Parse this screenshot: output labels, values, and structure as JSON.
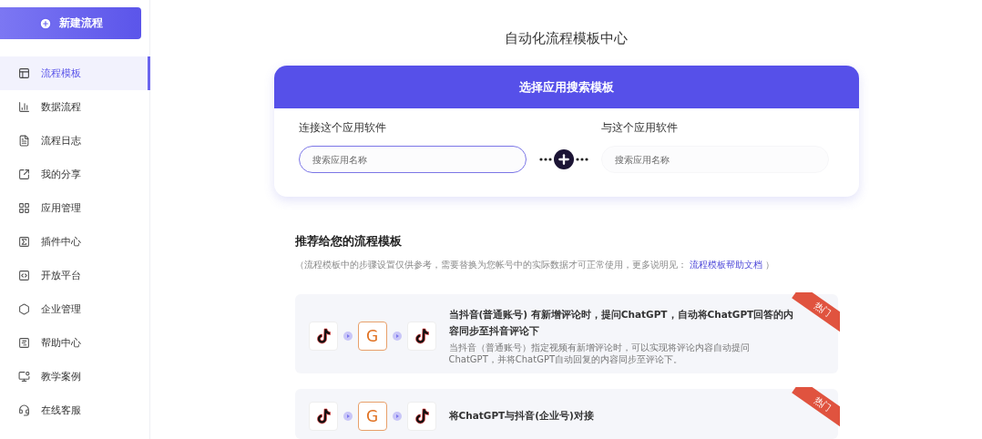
{
  "sidebar": {
    "new_button": "新建流程",
    "items": [
      {
        "label": "流程模板",
        "selected": true
      },
      {
        "label": "数据流程",
        "selected": false
      },
      {
        "label": "流程日志",
        "selected": false
      },
      {
        "label": "我的分享",
        "selected": false
      },
      {
        "label": "应用管理",
        "selected": false
      },
      {
        "label": "插件中心",
        "selected": false
      },
      {
        "label": "开放平台",
        "selected": false
      },
      {
        "label": "企业管理",
        "selected": false
      },
      {
        "label": "帮助中心",
        "selected": false
      },
      {
        "label": "教学案例",
        "selected": false
      },
      {
        "label": "在线客服",
        "selected": false
      }
    ]
  },
  "page_title": "自动化流程模板中心",
  "search_card": {
    "title": "选择应用搜索模板",
    "fields": [
      {
        "label": "连接这个应用软件",
        "placeholder": "搜索应用名称",
        "focused": true
      },
      {
        "label": "与这个应用软件",
        "placeholder": "搜索应用名称",
        "focused": false
      }
    ]
  },
  "recommend": {
    "title": "推荐给您的流程模板",
    "note_prefix": "（流程模板中的步骤设置仅供参考，需要替换为您帐号中的实际数据才可正常使用，更多说明见：",
    "note_link": "流程模板帮助文档",
    "note_suffix": "）",
    "templates": [
      {
        "apps": [
          {
            "kind": "douyin"
          },
          {
            "kind": "letter",
            "label": "G"
          },
          {
            "kind": "douyin"
          }
        ],
        "badge": "热门",
        "title": "当抖音(普通账号) 有新增评论时，提问ChatGPT，自动将ChatGPT回答的内容同步至抖音评论下",
        "description": "当抖音（普通账号）指定视频有新增评论时，可以实现将评论内容自动提问ChatGPT，并将ChatGPT自动回复的内容同步至评论下。"
      },
      {
        "apps": [
          {
            "kind": "douyin"
          },
          {
            "kind": "letter",
            "label": "G"
          },
          {
            "kind": "douyin"
          }
        ],
        "badge": "热门",
        "title": "将ChatGPT与抖音(企业号)对接"
      }
    ]
  }
}
